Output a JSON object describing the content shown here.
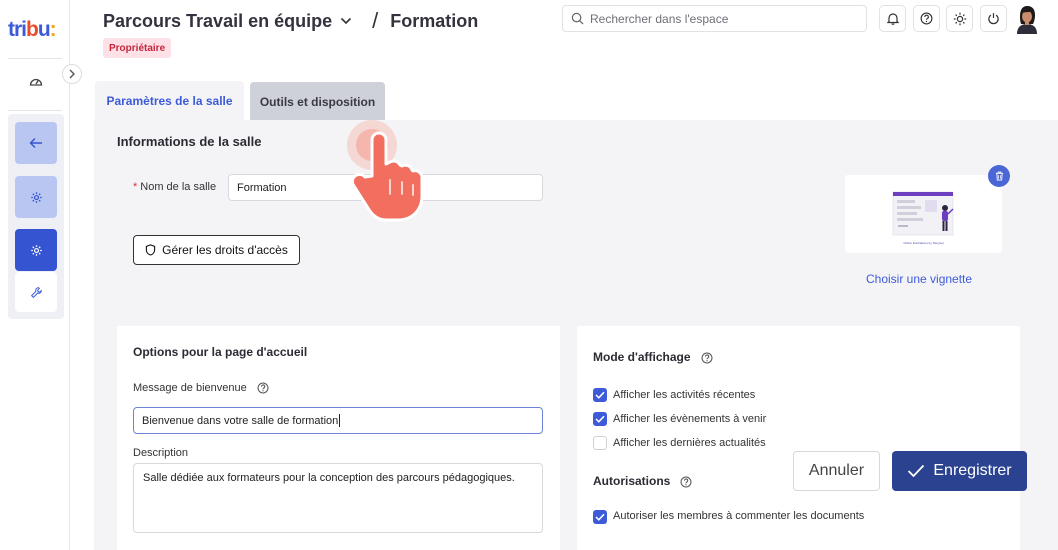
{
  "app": {
    "logo_a": "tri",
    "logo_b": "b",
    "logo_c": "u",
    "logo_d": ":"
  },
  "header": {
    "parcours": "Parcours Travail en équipe",
    "section": "Formation",
    "badge": "Propriétaire",
    "search_placeholder": "Rechercher dans l'espace"
  },
  "tabs": [
    {
      "label": "Paramètres de la salle",
      "active": true
    },
    {
      "label": "Outils et disposition",
      "active": false
    }
  ],
  "room_info": {
    "title": "Informations de la salle",
    "required_mark": "*",
    "name_label": "Nom de la salle",
    "name_value": "Formation",
    "access_button": "Gérer les droits d'accès",
    "thumbnail_link": "Choisir une vignette",
    "thumbnail_caption": "Online illustrations by Storyset"
  },
  "home_options": {
    "title": "Options pour la page d'accueil",
    "welcome_label": "Message de bienvenue",
    "welcome_value": "Bienvenue dans votre salle de formation",
    "description_label": "Description",
    "description_value": "Salle dédiée aux formateurs pour la conception des parcours pédagogiques."
  },
  "display_mode": {
    "title": "Mode d'affichage",
    "options": [
      {
        "label": "Afficher les activités récentes",
        "checked": true
      },
      {
        "label": "Afficher les évènements à venir",
        "checked": true
      },
      {
        "label": "Afficher les dernières actualités",
        "checked": false
      }
    ]
  },
  "permissions": {
    "title": "Autorisations",
    "options": [
      {
        "label": "Autoriser les membres à commenter les documents",
        "checked": true
      }
    ]
  },
  "actions": {
    "cancel": "Annuler",
    "save": "Enregistrer"
  },
  "colors": {
    "primary": "#3554d1",
    "primary_dark": "#2b4290",
    "badge_bg": "#fde1e6",
    "badge_text": "#c4263d",
    "hand": "#f26f5f"
  },
  "icons": [
    "dashboard-icon",
    "chevron-right-icon",
    "arrow-left-icon",
    "gear-icon",
    "wrench-icon",
    "search-icon",
    "bell-icon",
    "help-icon",
    "sun-icon",
    "power-icon",
    "shield-icon",
    "trash-icon",
    "check-icon",
    "pointer-hand-icon"
  ]
}
